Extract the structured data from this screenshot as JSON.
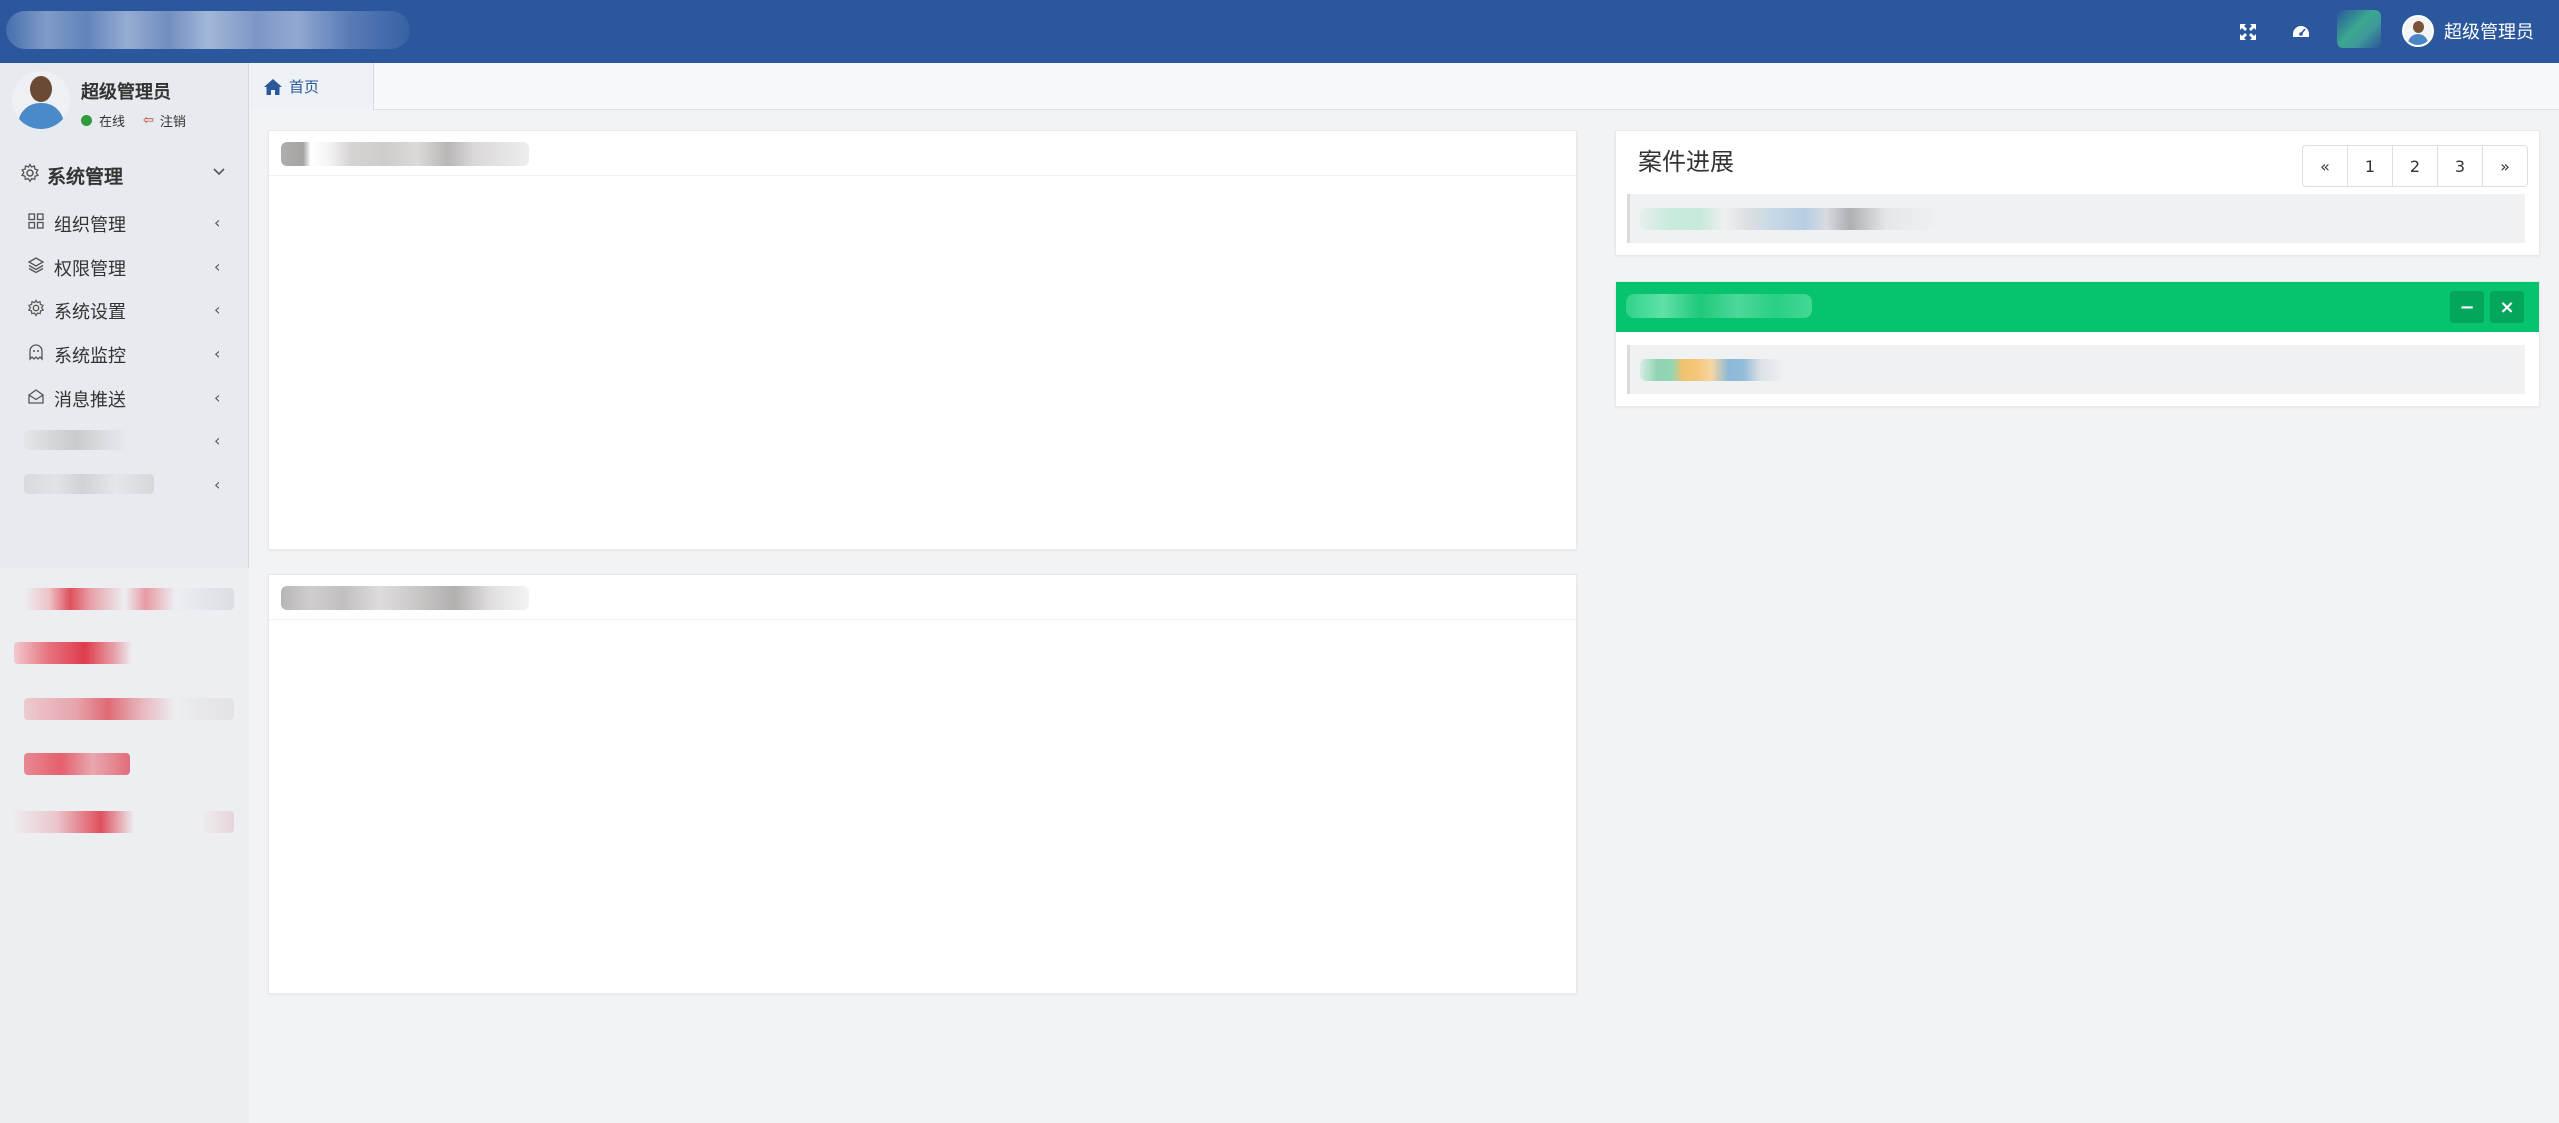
{
  "header": {
    "username": "超级管理员",
    "icons": [
      "fullscreen-icon",
      "dashboard-icon",
      "language-icon"
    ]
  },
  "sidebar": {
    "profile": {
      "name": "超级管理员",
      "status": "在线",
      "logout": "注销"
    },
    "group": {
      "label": "系统管理",
      "icon": "gear-icon"
    },
    "items": [
      {
        "label": "组织管理",
        "icon": "grid-icon"
      },
      {
        "label": "权限管理",
        "icon": "layers-icon"
      },
      {
        "label": "系统设置",
        "icon": "gear-icon"
      },
      {
        "label": "系统监控",
        "icon": "ghost-icon"
      },
      {
        "label": "消息推送",
        "icon": "mail-icon"
      }
    ]
  },
  "tabs": {
    "home": "首页"
  },
  "progress_panel": {
    "title": "案件进展",
    "pager": [
      "«",
      "1",
      "2",
      "3",
      "»"
    ]
  },
  "colors": {
    "header": "#2b579c",
    "green_panel": "#06c46e",
    "sidebar": "#e7eaee"
  }
}
